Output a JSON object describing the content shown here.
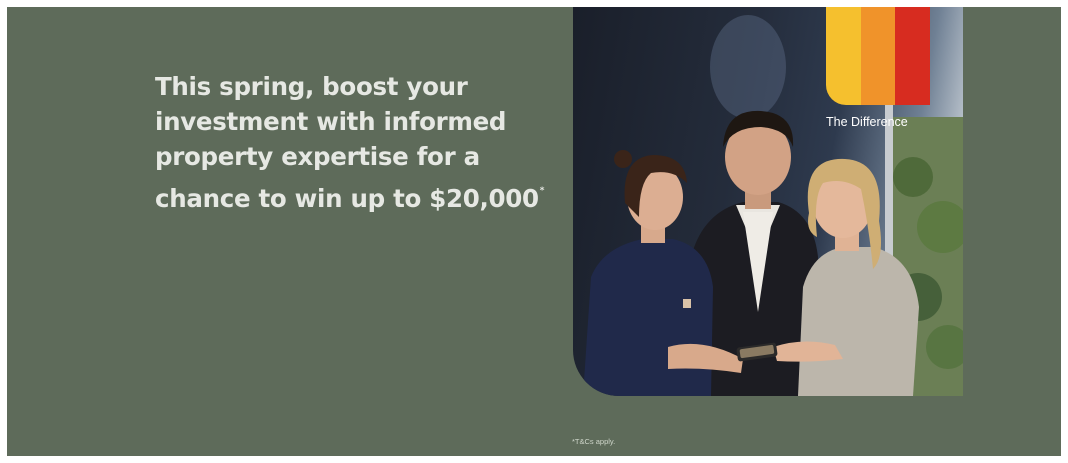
{
  "promo": {
    "headline_lines": [
      "This spring, boost your",
      "investment with informed",
      "property expertise for a",
      "chance to win up to $20,000"
    ],
    "headline_marker": "*",
    "brand_tagline": "The Difference",
    "terms": "*T&Cs apply.",
    "image": "three people looking at a smartphone"
  },
  "colors": {
    "background": "#5e6b5a",
    "headline_text": "#e6e8e3",
    "logo_yellow": "#f5c02e",
    "logo_orange": "#f0932a",
    "logo_red": "#d72c20"
  }
}
